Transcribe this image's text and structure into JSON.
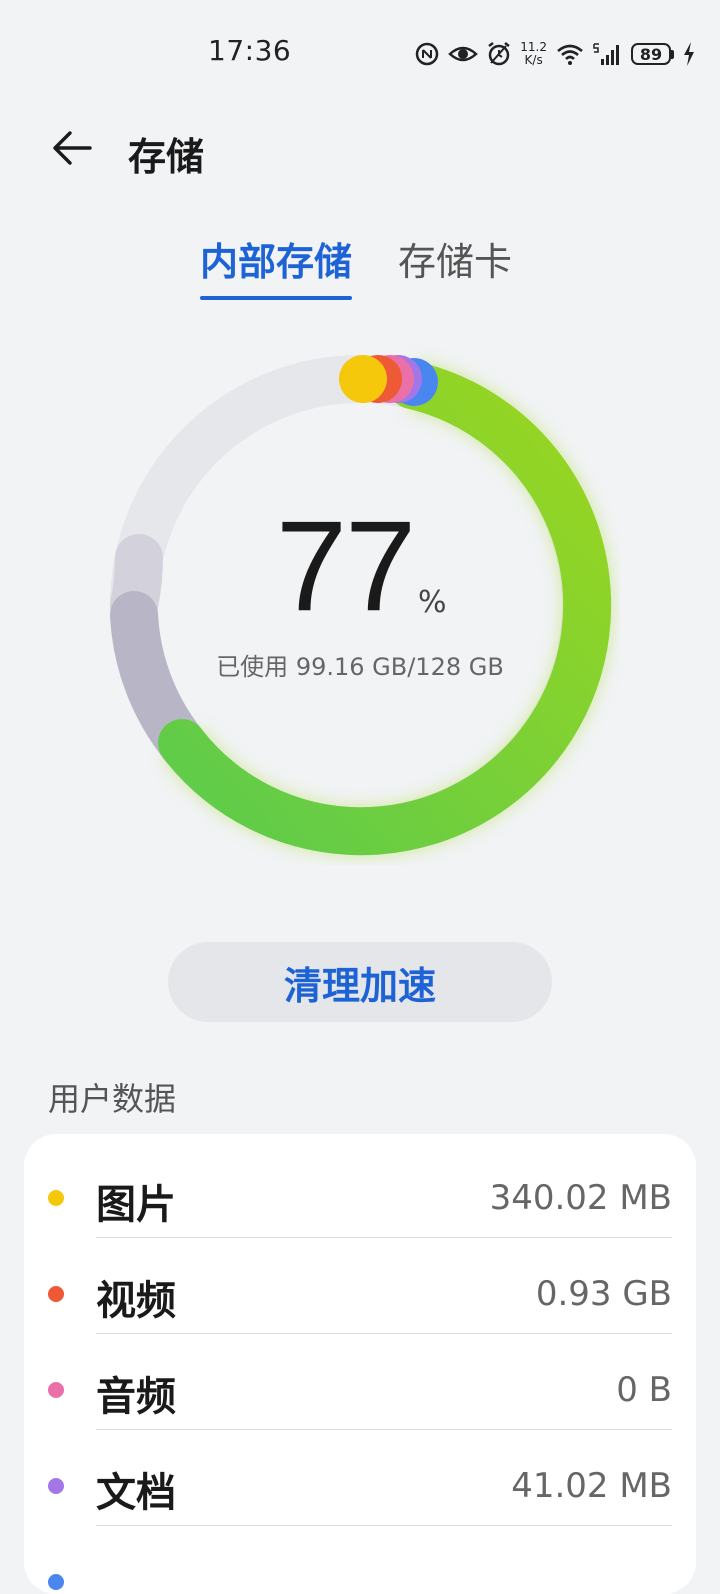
{
  "status_bar": {
    "time": "17:36",
    "network_speed_value": "11.2",
    "network_speed_unit": "K/s",
    "battery_level": "89",
    "icons": [
      "nfc-icon",
      "eye-icon",
      "alarm-icon",
      "wifi-icon",
      "signal-5g-icon",
      "battery-icon",
      "charging-icon"
    ]
  },
  "header": {
    "title": "存储",
    "back_icon": "back-arrow-icon"
  },
  "tabs": [
    {
      "label": "内部存储",
      "selected": true
    },
    {
      "label": "存储卡",
      "selected": false
    }
  ],
  "usage": {
    "percent": "77",
    "percent_sign": "%",
    "used_text": "已使用 99.16 GB/128 GB"
  },
  "chart_data": {
    "type": "pie",
    "total_gb": 128,
    "used_gb": 99.16,
    "used_percent": 77
  },
  "clean_button": {
    "label": "清理加速"
  },
  "user_data": {
    "section_title": "用户数据",
    "items": [
      {
        "label": "图片",
        "value": "340.02 MB",
        "color": "#f5c80b"
      },
      {
        "label": "视频",
        "value": "0.93 GB",
        "color": "#ee5a35"
      },
      {
        "label": "音频",
        "value": "0 B",
        "color": "#ec70a8"
      },
      {
        "label": "文档",
        "value": "41.02 MB",
        "color": "#a377e8"
      },
      {
        "label": "",
        "value": "",
        "color": "#4a86f0"
      }
    ]
  },
  "colors": {
    "accent": "#1d63d6",
    "apps_green": "#8fd42a",
    "system_gray": "#b8b6c6",
    "other_gray": "#d2d1dc",
    "free_track": "#e6e7ea"
  }
}
